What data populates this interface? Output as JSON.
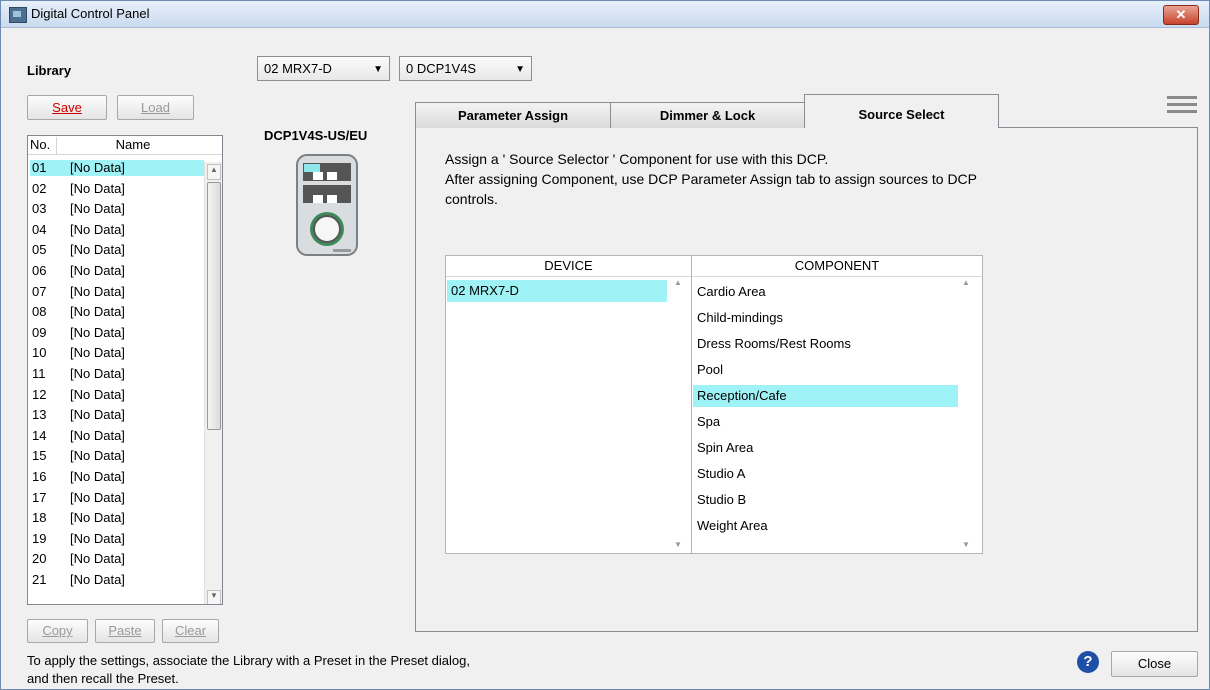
{
  "window": {
    "title": "Digital Control Panel"
  },
  "library": {
    "label": "Library",
    "save_label": "Save",
    "load_label": "Load",
    "header_no": "No.",
    "header_name": "Name",
    "rows": [
      {
        "no": "01",
        "name": "[No Data]"
      },
      {
        "no": "02",
        "name": "[No Data]"
      },
      {
        "no": "03",
        "name": "[No Data]"
      },
      {
        "no": "04",
        "name": "[No Data]"
      },
      {
        "no": "05",
        "name": "[No Data]"
      },
      {
        "no": "06",
        "name": "[No Data]"
      },
      {
        "no": "07",
        "name": "[No Data]"
      },
      {
        "no": "08",
        "name": "[No Data]"
      },
      {
        "no": "09",
        "name": "[No Data]"
      },
      {
        "no": "10",
        "name": "[No Data]"
      },
      {
        "no": "11",
        "name": "[No Data]"
      },
      {
        "no": "12",
        "name": "[No Data]"
      },
      {
        "no": "13",
        "name": "[No Data]"
      },
      {
        "no": "14",
        "name": "[No Data]"
      },
      {
        "no": "15",
        "name": "[No Data]"
      },
      {
        "no": "16",
        "name": "[No Data]"
      },
      {
        "no": "17",
        "name": "[No Data]"
      },
      {
        "no": "18",
        "name": "[No Data]"
      },
      {
        "no": "19",
        "name": "[No Data]"
      },
      {
        "no": "20",
        "name": "[No Data]"
      },
      {
        "no": "21",
        "name": "[No Data]"
      }
    ],
    "copy_label": "Copy",
    "paste_label": "Paste",
    "clear_label": "Clear"
  },
  "selectors": {
    "device": "02 MRX7-D",
    "dcp": "0 DCP1V4S"
  },
  "dcp_model": "DCP1V4S-US/EU",
  "tabs": [
    {
      "label": "Parameter Assign"
    },
    {
      "label": "Dimmer & Lock"
    },
    {
      "label": "Source Select"
    }
  ],
  "source_select": {
    "description_line1": "Assign a ' Source Selector ' Component for use with this DCP.",
    "description_line2": "After assigning Component, use DCP Parameter Assign tab to assign sources to DCP",
    "description_line3": "controls.",
    "device_header": "DEVICE",
    "component_header": "COMPONENT",
    "devices": [
      "02 MRX7-D"
    ],
    "components": [
      "Cardio Area",
      "Child-mindings",
      "Dress Rooms/Rest Rooms",
      "Pool",
      "Reception/Cafe",
      "Spa",
      "Spin Area",
      "Studio A",
      "Studio B",
      "Weight Area"
    ],
    "selected_component": "Reception/Cafe"
  },
  "footer": {
    "hint_line1": "To apply the settings, associate the Library with a Preset in the Preset dialog,",
    "hint_line2": "and then recall the Preset.",
    "close_label": "Close",
    "help_glyph": "?"
  },
  "colors": {
    "selection": "#9ff3f7",
    "accent_red": "#cc0000",
    "help_blue": "#1f4fa6"
  }
}
